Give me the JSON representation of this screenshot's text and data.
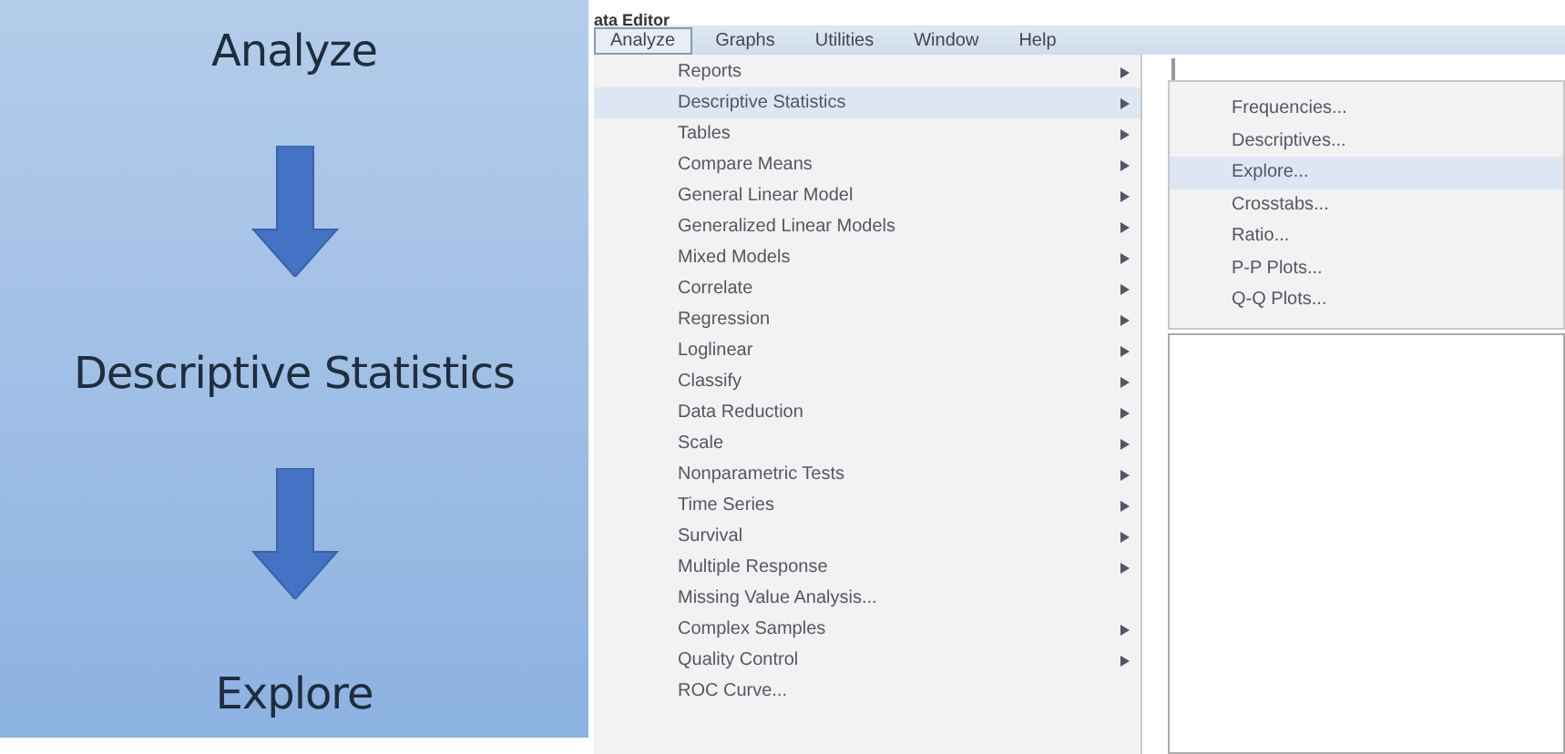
{
  "steps": [
    "Analyze",
    "Descriptive Statistics",
    "Explore"
  ],
  "window": {
    "title": "ata Editor"
  },
  "menu_bar": [
    {
      "label": "Analyze",
      "selected": true
    },
    {
      "label": "Graphs",
      "selected": false
    },
    {
      "label": "Utilities",
      "selected": false
    },
    {
      "label": "Window",
      "selected": false
    },
    {
      "label": "Help",
      "selected": false
    }
  ],
  "menu": [
    {
      "label": "Reports",
      "submenu": true,
      "selected": false
    },
    {
      "label": "Descriptive Statistics",
      "submenu": true,
      "selected": true
    },
    {
      "label": "Tables",
      "submenu": true,
      "selected": false
    },
    {
      "label": "Compare Means",
      "submenu": true,
      "selected": false
    },
    {
      "label": "General Linear Model",
      "submenu": true,
      "selected": false
    },
    {
      "label": "Generalized Linear Models",
      "submenu": true,
      "selected": false
    },
    {
      "label": "Mixed Models",
      "submenu": true,
      "selected": false
    },
    {
      "label": "Correlate",
      "submenu": true,
      "selected": false
    },
    {
      "label": "Regression",
      "submenu": true,
      "selected": false
    },
    {
      "label": "Loglinear",
      "submenu": true,
      "selected": false
    },
    {
      "label": "Classify",
      "submenu": true,
      "selected": false
    },
    {
      "label": "Data Reduction",
      "submenu": true,
      "selected": false
    },
    {
      "label": "Scale",
      "submenu": true,
      "selected": false
    },
    {
      "label": "Nonparametric Tests",
      "submenu": true,
      "selected": false
    },
    {
      "label": "Time Series",
      "submenu": true,
      "selected": false
    },
    {
      "label": "Survival",
      "submenu": true,
      "selected": false
    },
    {
      "label": "Multiple Response",
      "submenu": true,
      "selected": false
    },
    {
      "label": "Missing Value Analysis...",
      "submenu": false,
      "selected": false
    },
    {
      "label": "Complex Samples",
      "submenu": true,
      "selected": false
    },
    {
      "label": "Quality Control",
      "submenu": true,
      "selected": false
    },
    {
      "label": "ROC Curve...",
      "submenu": false,
      "selected": false
    }
  ],
  "submenu": [
    {
      "label": "Frequencies...",
      "selected": false
    },
    {
      "label": "Descriptives...",
      "selected": false
    },
    {
      "label": "Explore...",
      "selected": true
    },
    {
      "label": "Crosstabs...",
      "selected": false
    },
    {
      "label": "Ratio...",
      "selected": false
    },
    {
      "label": "P-P Plots...",
      "selected": false
    },
    {
      "label": "Q-Q Plots...",
      "selected": false
    }
  ]
}
